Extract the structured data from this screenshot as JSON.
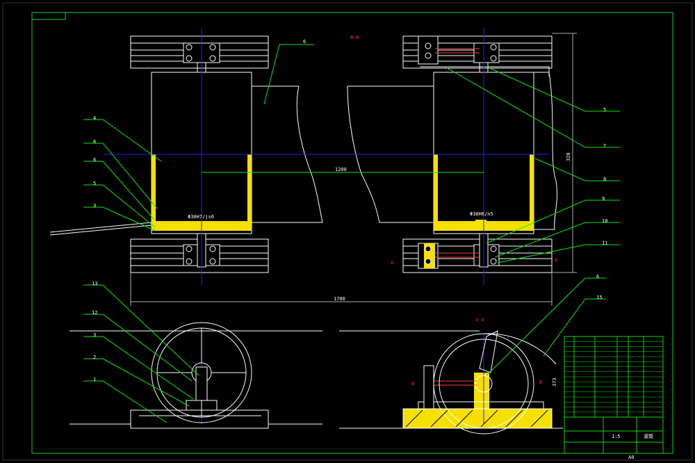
{
  "colors": {
    "background": "#000000",
    "outline": "#ffffff",
    "frame": "#00dd00",
    "centerline": "#2222ff",
    "leader": "#00ee00",
    "section": "#ff2020",
    "hatch": "#f5e000",
    "bolt": "#ff4040",
    "dimension": "#b0b0b0"
  },
  "section_labels": {
    "bb_top": "B-B",
    "aa_bottom": "A-A",
    "arrow_a_left": "A",
    "arrow_a_right": "A",
    "arrow_b_left": "B",
    "arrow_b_right": "B"
  },
  "dimensions": {
    "center_distance": "1200",
    "overall_length": "1700",
    "height_right": "320",
    "fit_left": "Φ30H7/js6",
    "fit_right": "Φ30H6/n5",
    "height_lower": "373"
  },
  "part_numbers": {
    "top_belt": "6",
    "top_left": [
      "4",
      "6",
      "6",
      "5",
      "3"
    ],
    "top_right": [
      "5",
      "7",
      "8",
      "9",
      "10",
      "11"
    ],
    "bottom_left": [
      "13",
      "12",
      "3",
      "2",
      "1"
    ],
    "bottom_right": [
      "6",
      "15"
    ]
  },
  "title_block": {
    "drawing_name": "滚筒",
    "scale": "1:5",
    "sheet": "A0"
  }
}
